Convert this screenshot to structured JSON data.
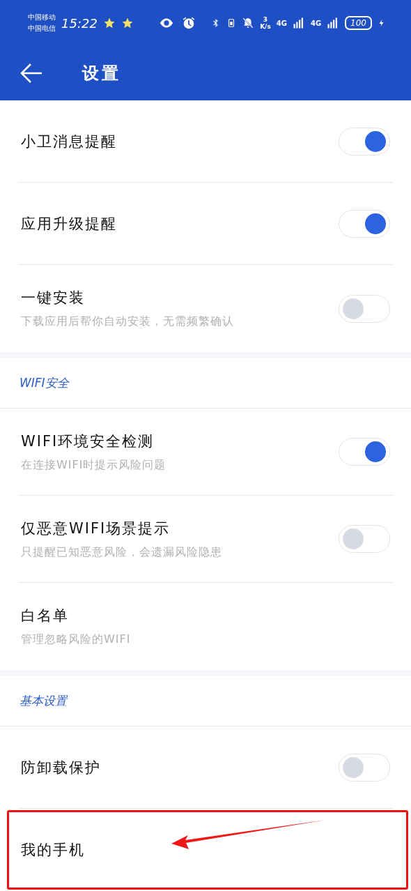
{
  "status_bar": {
    "carriers": [
      "中国移动",
      "中国电信"
    ],
    "time": "15:22",
    "speed_value": "3",
    "speed_unit": "K/s",
    "networks": [
      "4G",
      "4G"
    ],
    "battery": "100"
  },
  "header": {
    "title": "设置"
  },
  "sections": [
    {
      "items": [
        {
          "kind": "toggle",
          "title": "小卫消息提醒",
          "on": true
        },
        {
          "kind": "toggle",
          "title": "应用升级提醒",
          "on": true
        },
        {
          "kind": "toggle",
          "title": "一键安装",
          "subtitle": "下载应用后帮你自动安装，无需频繁确认",
          "on": false
        }
      ]
    },
    {
      "heading": "WIFI安全",
      "items": [
        {
          "kind": "toggle",
          "title": "WIFI环境安全检测",
          "subtitle": "在连接WIFI时提示风险问题",
          "on": true
        },
        {
          "kind": "toggle",
          "title": "仅恶意WIFI场景提示",
          "subtitle": "只提醒已知恶意风险，会遗漏风险隐患",
          "on": false
        },
        {
          "kind": "link",
          "title": "白名单",
          "subtitle": "管理忽略风险的WIFI"
        }
      ]
    },
    {
      "heading": "基本设置",
      "items": [
        {
          "kind": "toggle",
          "title": "防卸载保护",
          "on": false
        },
        {
          "kind": "link",
          "title": "我的手机",
          "annotated": true
        }
      ]
    }
  ]
}
